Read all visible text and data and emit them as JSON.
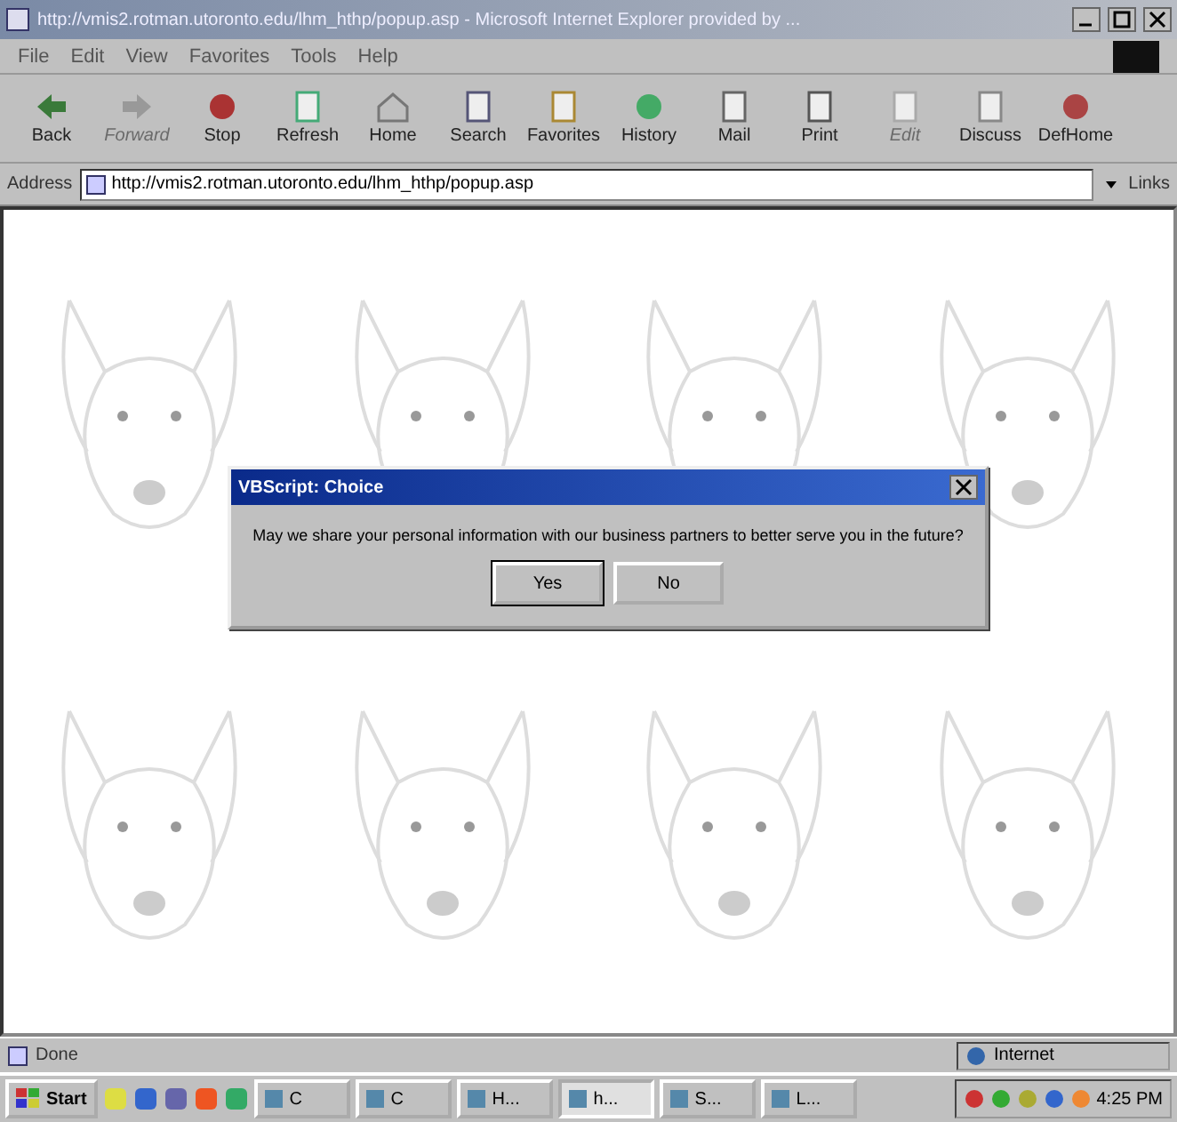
{
  "window": {
    "title": "http://vmis2.rotman.utoronto.edu/lhm_hthp/popup.asp - Microsoft Internet Explorer provided by ..."
  },
  "menu": [
    "File",
    "Edit",
    "View",
    "Favorites",
    "Tools",
    "Help"
  ],
  "toolbar": [
    {
      "label": "Back",
      "disabled": false
    },
    {
      "label": "Forward",
      "disabled": true
    },
    {
      "label": "Stop",
      "disabled": false
    },
    {
      "label": "Refresh",
      "disabled": false
    },
    {
      "label": "Home",
      "disabled": false
    },
    {
      "label": "Search",
      "disabled": false
    },
    {
      "label": "Favorites",
      "disabled": false
    },
    {
      "label": "History",
      "disabled": false
    },
    {
      "label": "Mail",
      "disabled": false
    },
    {
      "label": "Print",
      "disabled": false
    },
    {
      "label": "Edit",
      "disabled": true
    },
    {
      "label": "Discuss",
      "disabled": false
    },
    {
      "label": "DefHome",
      "disabled": false
    }
  ],
  "address": {
    "label": "Address",
    "value": "http://vmis2.rotman.utoronto.edu/lhm_hthp/popup.asp",
    "links": "Links"
  },
  "dialog": {
    "title": "VBScript: Choice",
    "message": "May we share your personal information with our business partners to better serve you in the future?",
    "buttons": [
      {
        "label": "Yes",
        "selected": true
      },
      {
        "label": "No",
        "selected": false
      }
    ]
  },
  "status_bar": {
    "text": "Done",
    "zone": "Internet"
  },
  "taskbar": {
    "start": "Start",
    "tasks": [
      {
        "label": "C",
        "selected": false
      },
      {
        "label": "C",
        "selected": false
      },
      {
        "label": "H...",
        "selected": false
      },
      {
        "label": "h...",
        "selected": true
      },
      {
        "label": "S...",
        "selected": false
      },
      {
        "label": "L...",
        "selected": false
      }
    ],
    "time": "4:25 PM"
  }
}
